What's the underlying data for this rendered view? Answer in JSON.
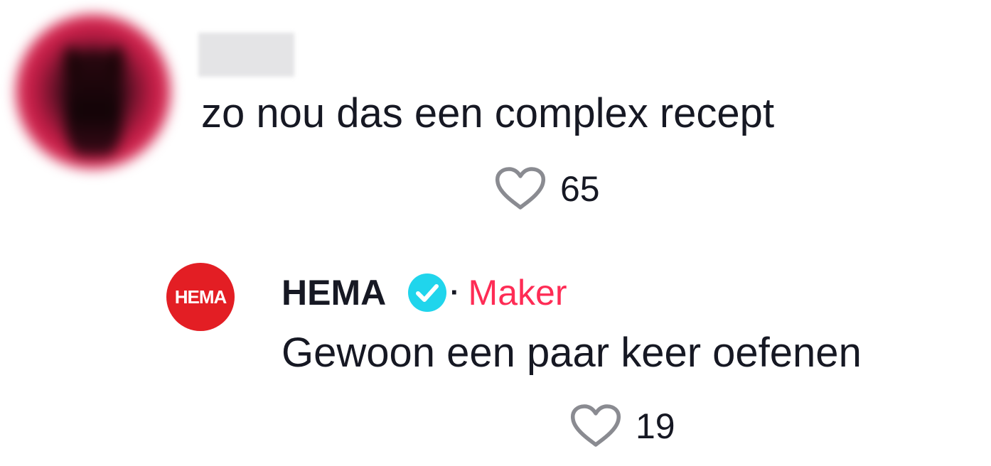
{
  "comments": [
    {
      "username": "",
      "text": "zo nou das een complex recept",
      "likes": "65",
      "avatar": "blurred-profile-photo"
    }
  ],
  "reply": {
    "username": "HEMA",
    "avatar_text": "HEMA",
    "verified": true,
    "separator": "·",
    "badge": "Maker",
    "text": "Gewoon een paar keer oefenen",
    "likes": "19"
  },
  "icons": {
    "like": "heart-outline-icon",
    "verified": "verified-check-icon"
  },
  "colors": {
    "text": "#161823",
    "maker_badge": "#fe2c55",
    "verified": "#20d5ec",
    "hema_red": "#e31e24",
    "heart_stroke": "#8a8b91"
  }
}
